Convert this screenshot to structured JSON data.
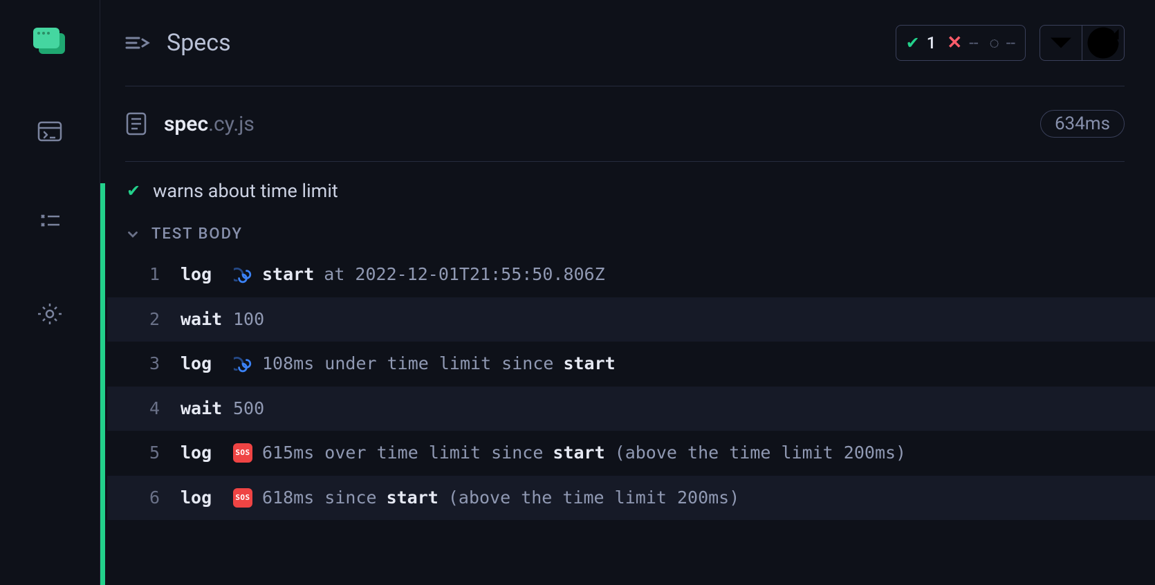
{
  "header": {
    "title": "Specs",
    "stats": {
      "passed": "1",
      "failed": "--",
      "pending": "--"
    }
  },
  "spec": {
    "basename": "spec",
    "ext": ".cy.js",
    "duration": "634ms"
  },
  "test": {
    "title": "warns about time limit",
    "sectionTitle": "TEST BODY",
    "commands": [
      {
        "n": "1",
        "cmd": "log",
        "icon": "cyclone",
        "parts": [
          {
            "t": "start",
            "w": true
          },
          {
            "t": "at 2022-12-01T21:55:50.806Z",
            "w": false
          }
        ]
      },
      {
        "n": "2",
        "cmd": "wait",
        "icon": "",
        "parts": [
          {
            "t": "100",
            "w": false
          }
        ]
      },
      {
        "n": "3",
        "cmd": "log",
        "icon": "cyclone",
        "parts": [
          {
            "t": "108ms under time limit since",
            "w": false
          },
          {
            "t": "start",
            "w": true
          }
        ]
      },
      {
        "n": "4",
        "cmd": "wait",
        "icon": "",
        "parts": [
          {
            "t": "500",
            "w": false
          }
        ]
      },
      {
        "n": "5",
        "cmd": "log",
        "icon": "sos",
        "parts": [
          {
            "t": "615ms over time limit since",
            "w": false
          },
          {
            "t": "start",
            "w": true
          },
          {
            "t": "(above the time limit 200ms)",
            "w": false
          }
        ]
      },
      {
        "n": "6",
        "cmd": "log",
        "icon": "sos",
        "parts": [
          {
            "t": "618ms since",
            "w": false
          },
          {
            "t": "start",
            "w": true
          },
          {
            "t": "(above the time limit 200ms)",
            "w": false
          }
        ]
      }
    ]
  },
  "sidebar": {
    "items": [
      "runner",
      "debug",
      "settings"
    ]
  }
}
